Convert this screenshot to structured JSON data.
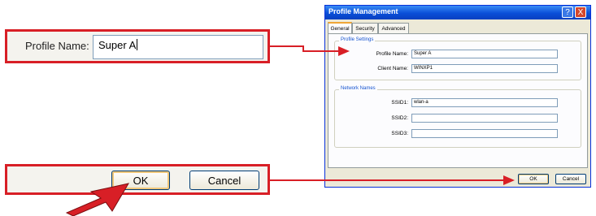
{
  "callout_name": {
    "label": "Profile Name:",
    "value": "Super A"
  },
  "callout_buttons": {
    "ok_label": "OK",
    "cancel_label": "Cancel"
  },
  "dialog": {
    "title": "Profile Management",
    "help_glyph": "?",
    "close_glyph": "X",
    "tabs": [
      "General",
      "Security",
      "Advanced"
    ],
    "active_tab": "General",
    "profile_settings": {
      "group_label": "Profile Settings",
      "profile_name_label": "Profile Name:",
      "profile_name_value": "Super A",
      "client_name_label": "Client Name:",
      "client_name_value": "WINXP1"
    },
    "network_names": {
      "group_label": "Network Names",
      "ssid1_label": "SSID1:",
      "ssid1_value": "wlan-a",
      "ssid2_label": "SSID2:",
      "ssid2_value": "",
      "ssid3_label": "SSID3:",
      "ssid3_value": ""
    },
    "ok_label": "OK",
    "cancel_label": "Cancel"
  },
  "colors": {
    "callout_red": "#d81f26",
    "titlebar_blue": "#0a4ed8",
    "dialog_face": "#ece9d8"
  },
  "icons": [
    "help-icon",
    "close-icon",
    "pointer-arrow-icon"
  ]
}
